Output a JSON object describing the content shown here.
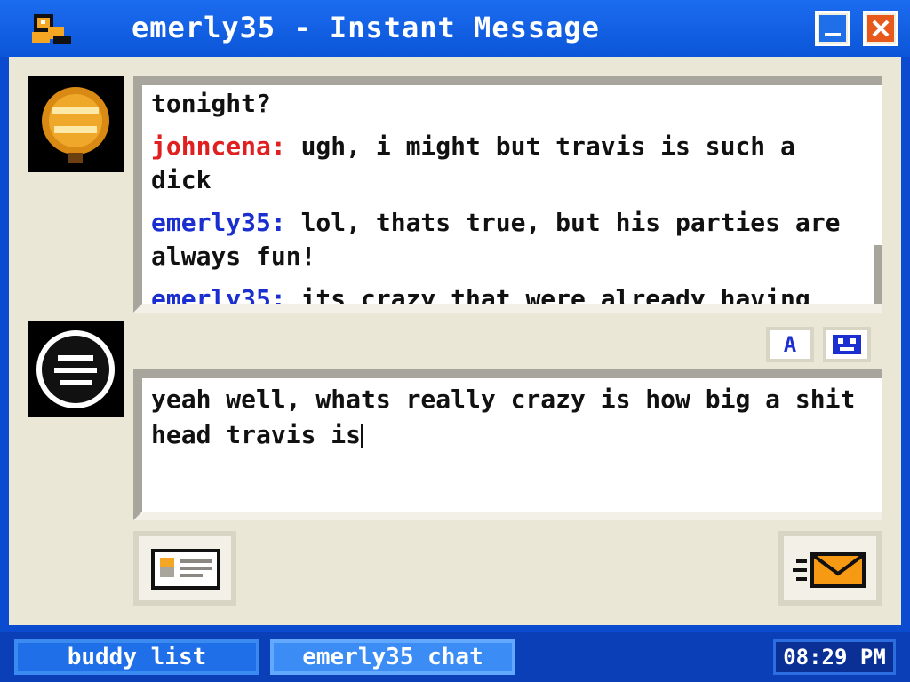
{
  "window": {
    "title": "emerly35 - Instant Message"
  },
  "conversation": {
    "lines": [
      {
        "sender": "",
        "text": "tonight?"
      },
      {
        "sender": "johncena:",
        "text": " ugh, i might but travis is such a dick",
        "color": "#e02020"
      },
      {
        "sender": "emerly35:",
        "text": " lol, thats true, but his parties are always fun!",
        "color": "#1b2fd0"
      },
      {
        "sender": "emerly35:",
        "text": " its crazy that were already having end of school parties.",
        "color": "#1b2fd0"
      }
    ]
  },
  "formatting": {
    "font_label": "A"
  },
  "compose": {
    "text": "yeah well, whats really crazy is how big a shit head travis is"
  },
  "taskbar": {
    "buddy_list": "buddy list",
    "chat": "emerly35 chat",
    "clock": "08:29 PM"
  },
  "icons": {
    "app": "duck-icon",
    "minimize": "minimize-icon",
    "close": "close-icon",
    "buddy_avatar": "cold-play-avatar",
    "self_avatar": "self-avatar",
    "emoticon": "emoticon-icon",
    "profile": "profile-card-icon",
    "send": "send-envelope-icon"
  },
  "colors": {
    "accent": "#0b55d8",
    "panel": "#ebe7d6",
    "buddy_name": "#e02020",
    "self_name": "#1b2fd0"
  }
}
